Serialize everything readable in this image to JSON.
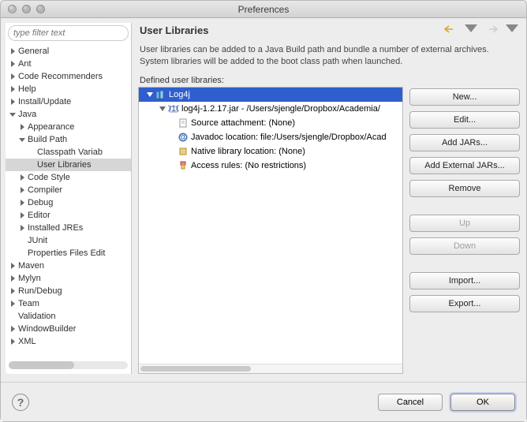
{
  "window": {
    "title": "Preferences"
  },
  "filter": {
    "placeholder": "type filter text"
  },
  "sidebar": {
    "items": [
      {
        "label": "General",
        "arrow": "right",
        "indent": 0
      },
      {
        "label": "Ant",
        "arrow": "right",
        "indent": 0
      },
      {
        "label": "Code Recommenders",
        "arrow": "right",
        "indent": 0
      },
      {
        "label": "Help",
        "arrow": "right",
        "indent": 0
      },
      {
        "label": "Install/Update",
        "arrow": "right",
        "indent": 0
      },
      {
        "label": "Java",
        "arrow": "down",
        "indent": 0
      },
      {
        "label": "Appearance",
        "arrow": "right",
        "indent": 1
      },
      {
        "label": "Build Path",
        "arrow": "down",
        "indent": 1
      },
      {
        "label": "Classpath Variab",
        "arrow": "",
        "indent": 2
      },
      {
        "label": "User Libraries",
        "arrow": "",
        "indent": 2,
        "selected": true
      },
      {
        "label": "Code Style",
        "arrow": "right",
        "indent": 1
      },
      {
        "label": "Compiler",
        "arrow": "right",
        "indent": 1
      },
      {
        "label": "Debug",
        "arrow": "right",
        "indent": 1
      },
      {
        "label": "Editor",
        "arrow": "right",
        "indent": 1
      },
      {
        "label": "Installed JREs",
        "arrow": "right",
        "indent": 1
      },
      {
        "label": "JUnit",
        "arrow": "",
        "indent": 1
      },
      {
        "label": "Properties Files Edit",
        "arrow": "",
        "indent": 1
      },
      {
        "label": "Maven",
        "arrow": "right",
        "indent": 0
      },
      {
        "label": "Mylyn",
        "arrow": "right",
        "indent": 0
      },
      {
        "label": "Run/Debug",
        "arrow": "right",
        "indent": 0
      },
      {
        "label": "Team",
        "arrow": "right",
        "indent": 0
      },
      {
        "label": "Validation",
        "arrow": "",
        "indent": 0
      },
      {
        "label": "WindowBuilder",
        "arrow": "right",
        "indent": 0
      },
      {
        "label": "XML",
        "arrow": "right",
        "indent": 0
      }
    ]
  },
  "panel": {
    "heading": "User Libraries",
    "description": "User libraries can be added to a Java Build path and bundle a number of external archives. System libraries will be added to the boot class path when launched.",
    "defined_label": "Defined user libraries:",
    "library": {
      "name": "Log4j",
      "jar": "log4j-1.2.17.jar - /Users/sjengle/Dropbox/Academia/",
      "source": "Source attachment: (None)",
      "javadoc": "Javadoc location: file:/Users/sjengle/Dropbox/Acad",
      "native": "Native library location: (None)",
      "access": "Access rules: (No restrictions)"
    }
  },
  "buttons": {
    "new": "New...",
    "edit": "Edit...",
    "add_jars": "Add JARs...",
    "add_ext": "Add External JARs...",
    "remove": "Remove",
    "up": "Up",
    "down": "Down",
    "import": "Import...",
    "export": "Export..."
  },
  "footer": {
    "cancel": "Cancel",
    "ok": "OK"
  }
}
